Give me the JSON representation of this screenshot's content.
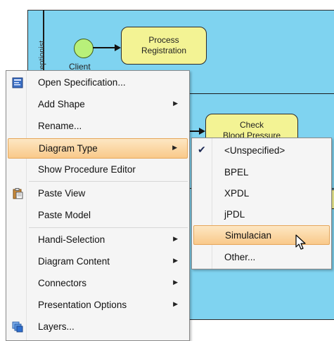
{
  "diagram": {
    "lane_title": "Receptionist",
    "start_event_label": "Client",
    "tasks": [
      {
        "label_line1": "Process",
        "label_line2": "Registration"
      },
      {
        "label_line1": "Check",
        "label_line2": "Blood Pressure"
      }
    ]
  },
  "context_menu": {
    "items": [
      {
        "label": "Open Specification...",
        "icon": "specification-icon",
        "has_submenu": false
      },
      {
        "label": "Add Shape",
        "icon": "",
        "has_submenu": true
      },
      {
        "label": "Rename...",
        "icon": "",
        "has_submenu": false
      },
      {
        "label": "Diagram Type",
        "icon": "",
        "has_submenu": true,
        "highlighted": true
      },
      {
        "label": "Show Procedure Editor",
        "icon": "",
        "has_submenu": false
      },
      {
        "label": "Paste View",
        "icon": "clipboard-icon",
        "has_submenu": false
      },
      {
        "label": "Paste Model",
        "icon": "",
        "has_submenu": false
      },
      {
        "label": "Handi-Selection",
        "icon": "",
        "has_submenu": true
      },
      {
        "label": "Diagram Content",
        "icon": "",
        "has_submenu": true
      },
      {
        "label": "Connectors",
        "icon": "",
        "has_submenu": true
      },
      {
        "label": "Presentation Options",
        "icon": "",
        "has_submenu": true
      },
      {
        "label": "Layers...",
        "icon": "layers-icon",
        "has_submenu": false
      }
    ]
  },
  "diagram_type_submenu": {
    "items": [
      {
        "label": "<Unspecified>",
        "checked": true
      },
      {
        "label": "BPEL",
        "checked": false
      },
      {
        "label": "XPDL",
        "checked": false
      },
      {
        "label": "jPDL",
        "checked": false
      },
      {
        "label": "Simulacian",
        "checked": false,
        "highlighted": true
      },
      {
        "label": "Other...",
        "checked": false
      }
    ]
  },
  "colors": {
    "pool": "#7fd3f0",
    "task_fill": "#f3f394",
    "start_event_fill": "#b8f07a",
    "menu_highlight": "#f9c98a"
  }
}
